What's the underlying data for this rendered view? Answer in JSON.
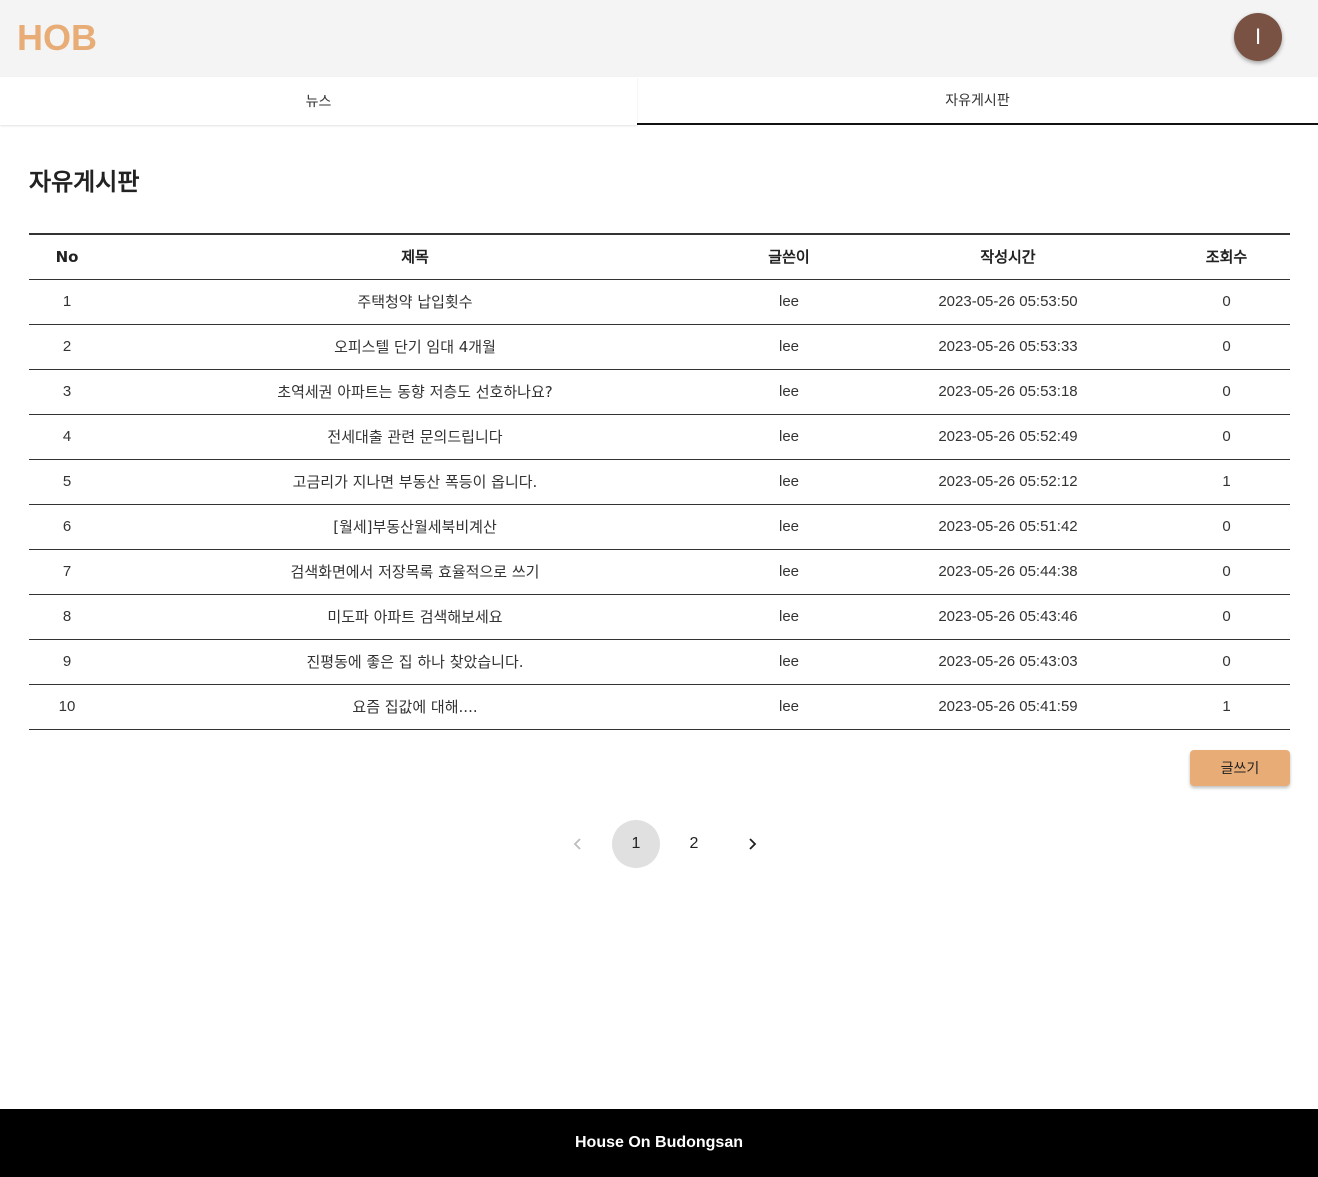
{
  "header": {
    "logo": "HOB",
    "avatar_initial": "I"
  },
  "tabs": [
    {
      "label": "뉴스",
      "active": false
    },
    {
      "label": "자유게시판",
      "active": true
    }
  ],
  "board": {
    "title": "자유게시판",
    "columns": {
      "no": "No",
      "title": "제목",
      "author": "글쓴이",
      "time": "작성시간",
      "views": "조회수"
    },
    "rows": [
      {
        "no": "1",
        "title": "주택청약 납입횟수",
        "author": "lee",
        "time": "2023-05-26 05:53:50",
        "views": "0"
      },
      {
        "no": "2",
        "title": "오피스텔 단기 임대 4개월",
        "author": "lee",
        "time": "2023-05-26 05:53:33",
        "views": "0"
      },
      {
        "no": "3",
        "title": "초역세권 아파트는 동향 저층도 선호하나요?",
        "author": "lee",
        "time": "2023-05-26 05:53:18",
        "views": "0"
      },
      {
        "no": "4",
        "title": "전세대출 관련 문의드립니다",
        "author": "lee",
        "time": "2023-05-26 05:52:49",
        "views": "0"
      },
      {
        "no": "5",
        "title": "고금리가 지나면 부동산 폭등이 옵니다.",
        "author": "lee",
        "time": "2023-05-26 05:52:12",
        "views": "1"
      },
      {
        "no": "6",
        "title": "[월세]부동산월세북비계산",
        "author": "lee",
        "time": "2023-05-26 05:51:42",
        "views": "0"
      },
      {
        "no": "7",
        "title": "검색화면에서 저장목록 효율적으로 쓰기",
        "author": "lee",
        "time": "2023-05-26 05:44:38",
        "views": "0"
      },
      {
        "no": "8",
        "title": "미도파 아파트 검색해보세요",
        "author": "lee",
        "time": "2023-05-26 05:43:46",
        "views": "0"
      },
      {
        "no": "9",
        "title": "진평동에 좋은 집 하나 찾았습니다.",
        "author": "lee",
        "time": "2023-05-26 05:43:03",
        "views": "0"
      },
      {
        "no": "10",
        "title": "요즘 집값에 대해....",
        "author": "lee",
        "time": "2023-05-26 05:41:59",
        "views": "1"
      }
    ],
    "write_button": "글쓰기"
  },
  "pagination": {
    "pages": [
      "1",
      "2"
    ],
    "current": "1",
    "prev_icon": "chevron-left-icon",
    "next_icon": "chevron-right-icon"
  },
  "footer": {
    "text": "House On Budongsan"
  },
  "colors": {
    "accent": "#e8ad77",
    "avatar": "#7a5243",
    "footer_bg": "#000000",
    "header_bg": "#f4f4f4"
  }
}
